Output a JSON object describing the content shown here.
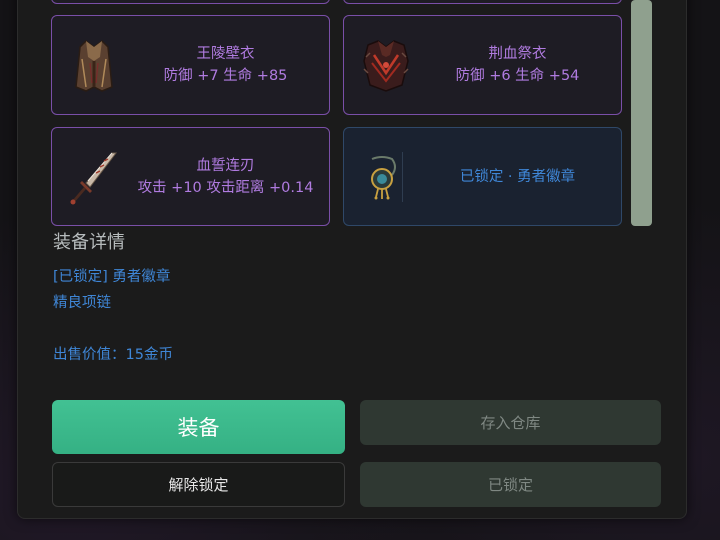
{
  "items": [
    {
      "name": "王陵壁衣",
      "stats": "防御 +7  生命 +85",
      "icon": "robe-icon"
    },
    {
      "name": "荆血祭衣",
      "stats": "防御 +6  生命 +54",
      "icon": "armor-icon"
    },
    {
      "name": "血誓连刃",
      "stats": "攻击 +10  攻击距离 +0.14",
      "icon": "blade-icon"
    },
    {
      "locked_label": "已锁定 · 勇者徽章",
      "icon": "amulet-icon"
    }
  ],
  "detail": {
    "title": "装备详情",
    "lock_line": "[已锁定] 勇者徽章",
    "type_line": "精良项链",
    "price_line": "出售价值：15金币"
  },
  "buttons": {
    "equip": "装备",
    "store": "存入仓库",
    "unlock": "解除锁定",
    "locked": "已锁定"
  },
  "colors": {
    "rarity_epic": "#b07be0",
    "locked_blue": "#3f86d6",
    "equip_green": "#3dbb8d"
  }
}
